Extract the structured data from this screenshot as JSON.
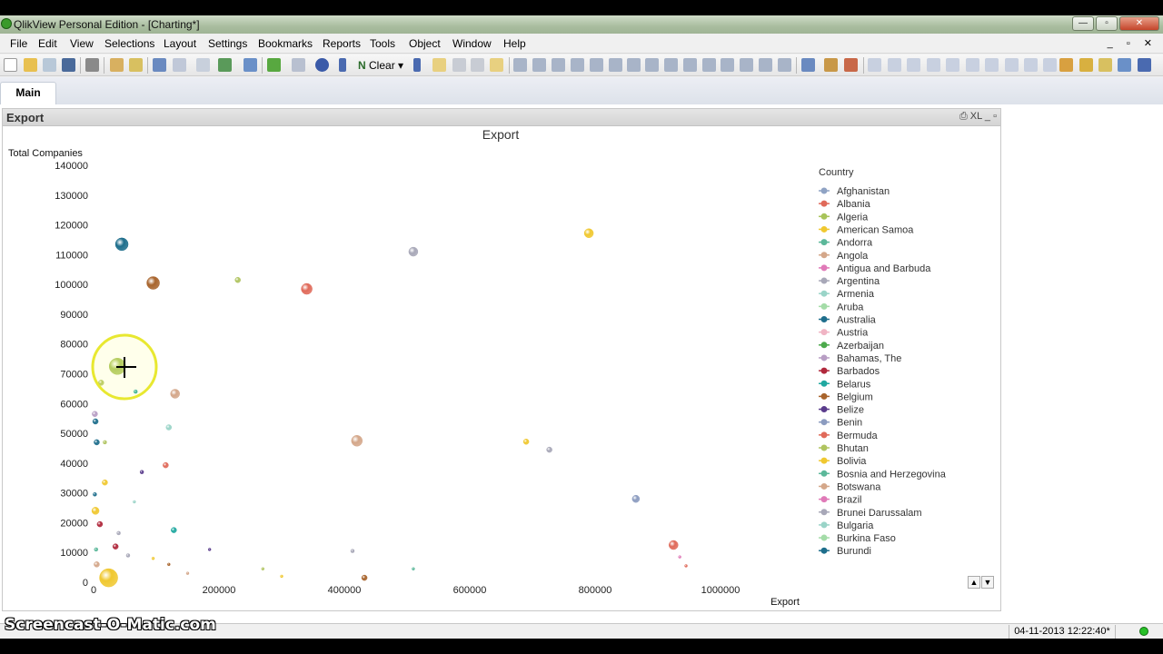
{
  "app": {
    "title": "QlikView Personal Edition - [Charting*]"
  },
  "window_buttons": {
    "minimize": "—",
    "restore": "▫",
    "close": "✕"
  },
  "menu": [
    "File",
    "Edit",
    "View",
    "Selections",
    "Layout",
    "Settings",
    "Bookmarks",
    "Reports",
    "Tools",
    "Object",
    "Window",
    "Help"
  ],
  "mdi_buttons": "_ ▫ ✕",
  "toolbar": {
    "clear_label": "Clear"
  },
  "tabs": [
    {
      "label": "Main",
      "active": true
    }
  ],
  "chart_object": {
    "caption": "Export",
    "caption_icons": "⎙ XL _ ▫"
  },
  "chart_data": {
    "type": "scatter",
    "title": "Export",
    "xlabel": "Export",
    "ylabel": "Total Companies",
    "xlim": [
      0,
      1100000
    ],
    "ylim": [
      0,
      140000
    ],
    "x_ticks": [
      0,
      200000,
      400000,
      600000,
      800000,
      1000000
    ],
    "y_ticks": [
      0,
      10000,
      20000,
      30000,
      40000,
      50000,
      60000,
      70000,
      80000,
      90000,
      100000,
      110000,
      120000,
      130000,
      140000
    ],
    "legend_title": "Country",
    "legend_position": "right",
    "series": [
      {
        "name": "Afghanistan",
        "color": "#8fa3c4"
      },
      {
        "name": "Albania",
        "color": "#e06a5a"
      },
      {
        "name": "Algeria",
        "color": "#a8c45a"
      },
      {
        "name": "American Samoa",
        "color": "#f0c830"
      },
      {
        "name": "Andorra",
        "color": "#5cb89a"
      },
      {
        "name": "Angola",
        "color": "#d4a78a"
      },
      {
        "name": "Antigua and Barbuda",
        "color": "#e07ab8"
      },
      {
        "name": "Argentina",
        "color": "#a8a8b8"
      },
      {
        "name": "Armenia",
        "color": "#9ad4c8"
      },
      {
        "name": "Aruba",
        "color": "#a4dca8"
      },
      {
        "name": "Australia",
        "color": "#1e6e8c"
      },
      {
        "name": "Austria",
        "color": "#f0b4c4"
      },
      {
        "name": "Azerbaijan",
        "color": "#4caa4c"
      },
      {
        "name": "Bahamas, The",
        "color": "#b89ec4"
      },
      {
        "name": "Barbados",
        "color": "#b0283c"
      },
      {
        "name": "Belarus",
        "color": "#20a8a0"
      },
      {
        "name": "Belgium",
        "color": "#a8642c"
      },
      {
        "name": "Belize",
        "color": "#5a3c8c"
      },
      {
        "name": "Benin",
        "color": "#8c9cc0"
      },
      {
        "name": "Bermuda",
        "color": "#e06a5a"
      },
      {
        "name": "Bhutan",
        "color": "#b0c460"
      },
      {
        "name": "Bolivia",
        "color": "#f0c830"
      },
      {
        "name": "Bosnia and Herzegovina",
        "color": "#5cb89a"
      },
      {
        "name": "Botswana",
        "color": "#d4a78a"
      },
      {
        "name": "Brazil",
        "color": "#e07ab8"
      },
      {
        "name": "Brunei Darussalam",
        "color": "#a8a8b8"
      },
      {
        "name": "Bulgaria",
        "color": "#9ad4c8"
      },
      {
        "name": "Burkina Faso",
        "color": "#a4dca8"
      },
      {
        "name": "Burundi",
        "color": "#1e6e8c"
      }
    ],
    "points": [
      {
        "x": 45000,
        "y": 113500,
        "c": "#1e6e8c",
        "r": 7
      },
      {
        "x": 95000,
        "y": 100500,
        "c": "#a8642c",
        "r": 7
      },
      {
        "x": 230000,
        "y": 101500,
        "c": "#b0c460",
        "r": 3
      },
      {
        "x": 340000,
        "y": 98500,
        "c": "#e06a5a",
        "r": 6
      },
      {
        "x": 510000,
        "y": 111000,
        "c": "#a8a8b8",
        "r": 5
      },
      {
        "x": 790000,
        "y": 117200,
        "c": "#f0c830",
        "r": 5
      },
      {
        "x": 38000,
        "y": 72500,
        "c": "#a8c45a",
        "r": 9
      },
      {
        "x": 12000,
        "y": 67000,
        "c": "#b0c460",
        "r": 3
      },
      {
        "x": 67000,
        "y": 64000,
        "c": "#20a8a0",
        "r": 2
      },
      {
        "x": 130000,
        "y": 63300,
        "c": "#d4a78a",
        "r": 5
      },
      {
        "x": 120000,
        "y": 52000,
        "c": "#9ad4c8",
        "r": 3
      },
      {
        "x": 420000,
        "y": 47500,
        "c": "#d4a78a",
        "r": 6
      },
      {
        "x": 690000,
        "y": 47200,
        "c": "#f0c830",
        "r": 3
      },
      {
        "x": 727000,
        "y": 44500,
        "c": "#a8a8b8",
        "r": 3
      },
      {
        "x": 115000,
        "y": 39300,
        "c": "#e06a5a",
        "r": 3
      },
      {
        "x": 77000,
        "y": 37000,
        "c": "#5a3c8c",
        "r": 2
      },
      {
        "x": 5000,
        "y": 47000,
        "c": "#1e6e8c",
        "r": 3
      },
      {
        "x": 18000,
        "y": 47000,
        "c": "#b0c460",
        "r": 2
      },
      {
        "x": 2000,
        "y": 56500,
        "c": "#b89ec4",
        "r": 3
      },
      {
        "x": 3000,
        "y": 54000,
        "c": "#1e6e8c",
        "r": 3
      },
      {
        "x": 18000,
        "y": 33500,
        "c": "#f0c830",
        "r": 3
      },
      {
        "x": 2000,
        "y": 29500,
        "c": "#1e6e8c",
        "r": 2
      },
      {
        "x": 3000,
        "y": 24000,
        "c": "#f0c830",
        "r": 4
      },
      {
        "x": 10000,
        "y": 19500,
        "c": "#b0283c",
        "r": 3
      },
      {
        "x": 128000,
        "y": 17500,
        "c": "#20a8a0",
        "r": 3
      },
      {
        "x": 865000,
        "y": 28000,
        "c": "#8c9cc0",
        "r": 4
      },
      {
        "x": 925000,
        "y": 12500,
        "c": "#e06a5a",
        "r": 5
      },
      {
        "x": 35000,
        "y": 12000,
        "c": "#b0283c",
        "r": 3
      },
      {
        "x": 413000,
        "y": 10500,
        "c": "#a8a8b8",
        "r": 2
      },
      {
        "x": 24000,
        "y": 1500,
        "c": "#f0c830",
        "r": 10
      },
      {
        "x": 5000,
        "y": 6000,
        "c": "#d4a78a",
        "r": 3
      },
      {
        "x": 432000,
        "y": 1500,
        "c": "#a8642c",
        "r": 3
      },
      {
        "x": 4000,
        "y": 11000,
        "c": "#5cb89a",
        "r": 2
      },
      {
        "x": 55000,
        "y": 9000,
        "c": "#a8a8b8",
        "r": 2
      },
      {
        "x": 150000,
        "y": 3000,
        "c": "#d4a78a",
        "r": 1.5
      },
      {
        "x": 300000,
        "y": 2000,
        "c": "#f0c830",
        "r": 1.5
      },
      {
        "x": 270000,
        "y": 4500,
        "c": "#b0c460",
        "r": 1.5
      },
      {
        "x": 185000,
        "y": 11000,
        "c": "#5a3c8c",
        "r": 1.5
      },
      {
        "x": 510000,
        "y": 4500,
        "c": "#5cb89a",
        "r": 1.5
      },
      {
        "x": 935000,
        "y": 8500,
        "c": "#e07ab8",
        "r": 1.5
      },
      {
        "x": 945000,
        "y": 5500,
        "c": "#e06a5a",
        "r": 1.5
      },
      {
        "x": 120000,
        "y": 6000,
        "c": "#a8642c",
        "r": 1.5
      },
      {
        "x": 95000,
        "y": 8000,
        "c": "#f0c830",
        "r": 1.5
      },
      {
        "x": 65000,
        "y": 27000,
        "c": "#9ad4c8",
        "r": 1.5
      },
      {
        "x": 40000,
        "y": 16500,
        "c": "#a8a8b8",
        "r": 2
      }
    ]
  },
  "status": {
    "datetime": "04-11-2013 12:22:40*"
  },
  "watermark": "Screencast-O-Matic.com"
}
